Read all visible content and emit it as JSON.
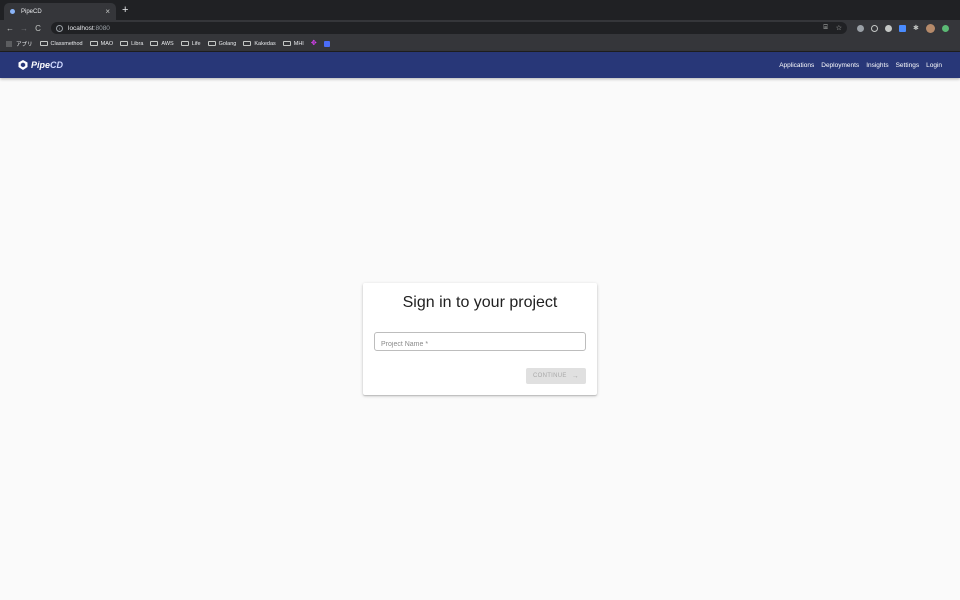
{
  "browser": {
    "tab_title": "PipeCD",
    "tab_close": "×",
    "new_tab": "+",
    "back": "←",
    "forward": "→",
    "reload": "C",
    "url_host": "localhost",
    "url_port": ":8080",
    "bookmarks": [
      "アプリ",
      "Classmethod",
      "MAO",
      "Libra",
      "AWS",
      "Life",
      "Golang",
      "Kakedas",
      "MHI"
    ]
  },
  "appbar": {
    "logo_text": "Pipe",
    "logo_accent": "CD",
    "nav": [
      "Applications",
      "Deployments",
      "Insights",
      "Settings",
      "Login"
    ]
  },
  "signin": {
    "title": "Sign in to your project",
    "project_placeholder": "Project Name *",
    "continue_label": "CONTINUE",
    "continue_icon": "→"
  },
  "colors": {
    "appbar": "#283778",
    "background": "#fafafa",
    "button_disabled": "#e0e0e0"
  }
}
